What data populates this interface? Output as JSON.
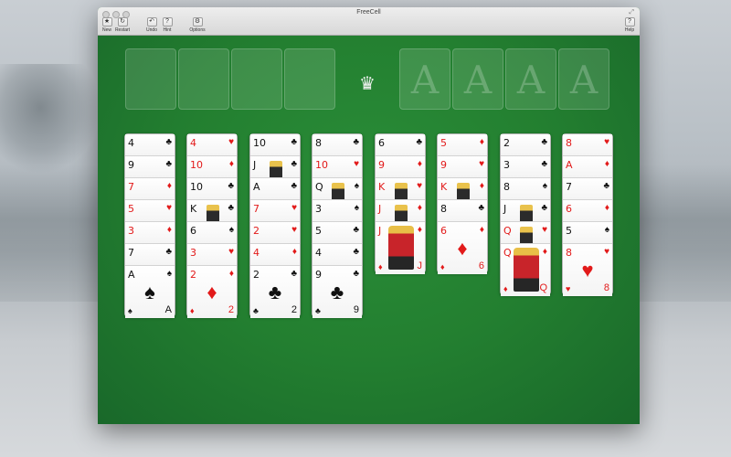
{
  "window": {
    "title": "FreeCell",
    "toolbar": [
      {
        "label": "New",
        "icon": "★"
      },
      {
        "label": "Restart",
        "icon": "↻"
      },
      {
        "label": "Undo",
        "icon": "↶"
      },
      {
        "label": "Hint",
        "icon": "?"
      },
      {
        "label": "Options",
        "icon": "⚙"
      }
    ],
    "help_label": "Help",
    "help_icon": "?"
  },
  "foundations": [
    "A",
    "A",
    "A",
    "A"
  ],
  "crown_icon": "♛",
  "columns": [
    {
      "cards": [
        [
          "4",
          "♣"
        ],
        [
          "9",
          "♣"
        ],
        [
          "7",
          "♦"
        ],
        [
          "5",
          "♥"
        ],
        [
          "3",
          "♦"
        ],
        [
          "7",
          "♣"
        ],
        [
          "A",
          "♠"
        ]
      ]
    },
    {
      "cards": [
        [
          "4",
          "♥"
        ],
        [
          "10",
          "♦"
        ],
        [
          "10",
          "♣"
        ],
        [
          "K",
          "♣"
        ],
        [
          "6",
          "♠"
        ],
        [
          "3",
          "♥"
        ],
        [
          "2",
          "♦"
        ]
      ]
    },
    {
      "cards": [
        [
          "10",
          "♣"
        ],
        [
          "J",
          "♣"
        ],
        [
          "A",
          "♣"
        ],
        [
          "7",
          "♥"
        ],
        [
          "2",
          "♥"
        ],
        [
          "4",
          "♦"
        ],
        [
          "2",
          "♣"
        ]
      ]
    },
    {
      "cards": [
        [
          "8",
          "♣"
        ],
        [
          "10",
          "♥"
        ],
        [
          "Q",
          "♠"
        ],
        [
          "3",
          "♠"
        ],
        [
          "5",
          "♣"
        ],
        [
          "4",
          "♣"
        ],
        [
          "9",
          "♣"
        ]
      ]
    },
    {
      "cards": [
        [
          "6",
          "♣"
        ],
        [
          "9",
          "♦"
        ],
        [
          "K",
          "♥"
        ],
        [
          "J",
          "♦"
        ],
        [
          "J",
          "♦"
        ]
      ]
    },
    {
      "cards": [
        [
          "5",
          "♦"
        ],
        [
          "9",
          "♥"
        ],
        [
          "K",
          "♦"
        ],
        [
          "8",
          "♣"
        ],
        [
          "6",
          "♦"
        ]
      ]
    },
    {
      "cards": [
        [
          "2",
          "♣"
        ],
        [
          "3",
          "♣"
        ],
        [
          "8",
          "♠"
        ],
        [
          "J",
          "♣"
        ],
        [
          "Q",
          "♥"
        ],
        [
          "Q",
          "♦"
        ]
      ]
    },
    {
      "cards": [
        [
          "8",
          "♥"
        ],
        [
          "A",
          "♦"
        ],
        [
          "7",
          "♣"
        ],
        [
          "6",
          "♦"
        ],
        [
          "5",
          "♠"
        ],
        [
          "8",
          "♥"
        ]
      ]
    }
  ]
}
